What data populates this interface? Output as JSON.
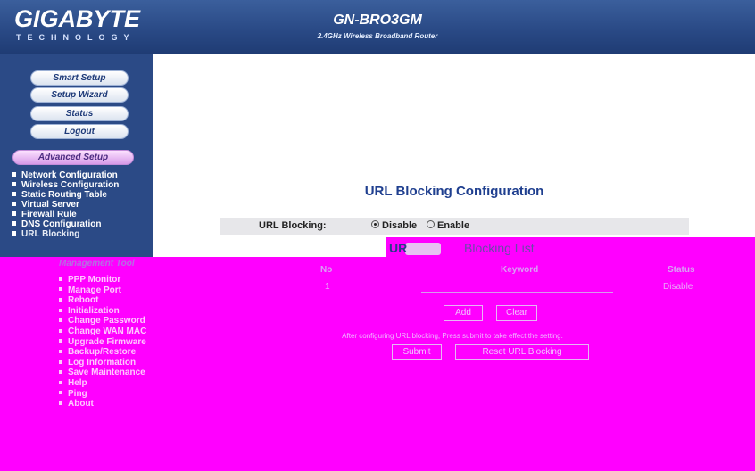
{
  "header": {
    "brand": "GIGABYTE",
    "brand_sub": "TECHNOLOGY",
    "model": "GN-BRO3GM",
    "model_sub": "2.4GHz Wireless Broadband Router"
  },
  "sidebar": {
    "buttons": [
      "Smart Setup",
      "Setup Wizard",
      "Status",
      "Logout"
    ],
    "advanced_label": "Advanced Setup",
    "items": [
      "Network Configuration",
      "Wireless Configuration",
      "Static Routing Table",
      "Virtual Server",
      "Firewall Rule",
      "DNS Configuration",
      "URL Blocking"
    ]
  },
  "main": {
    "title": "URL Blocking Configuration",
    "url_blocking_label": "URL Blocking:",
    "radio": {
      "disable": "Disable",
      "enable": "Enable",
      "selected": "Disable"
    },
    "list_title_a": "UR",
    "list_title_b": "Blocking List",
    "table": {
      "headers": [
        "No",
        "Keyword",
        "Status"
      ],
      "rows": [
        {
          "no": "1",
          "keyword": "",
          "status": "Disable"
        }
      ]
    },
    "buttons": {
      "add": "Add",
      "clear": "Clear",
      "submit": "Submit",
      "reset": "Reset URL Blocking"
    },
    "note": "After configuring URL blocking, Press submit to take effect the setting."
  },
  "management": {
    "title": "Management Tool",
    "items": [
      "PPP Monitor",
      "Manage Port",
      "Reboot",
      "Initialization",
      "Change Password",
      "Change WAN MAC",
      "Upgrade Firmware",
      "Backup/Restore",
      "Log Information",
      "Save Maintenance",
      "Help",
      "Ping",
      "About"
    ]
  },
  "colors": {
    "header": "#2a4a86",
    "accent": "#ff00ff",
    "title": "#1f3f8f"
  }
}
